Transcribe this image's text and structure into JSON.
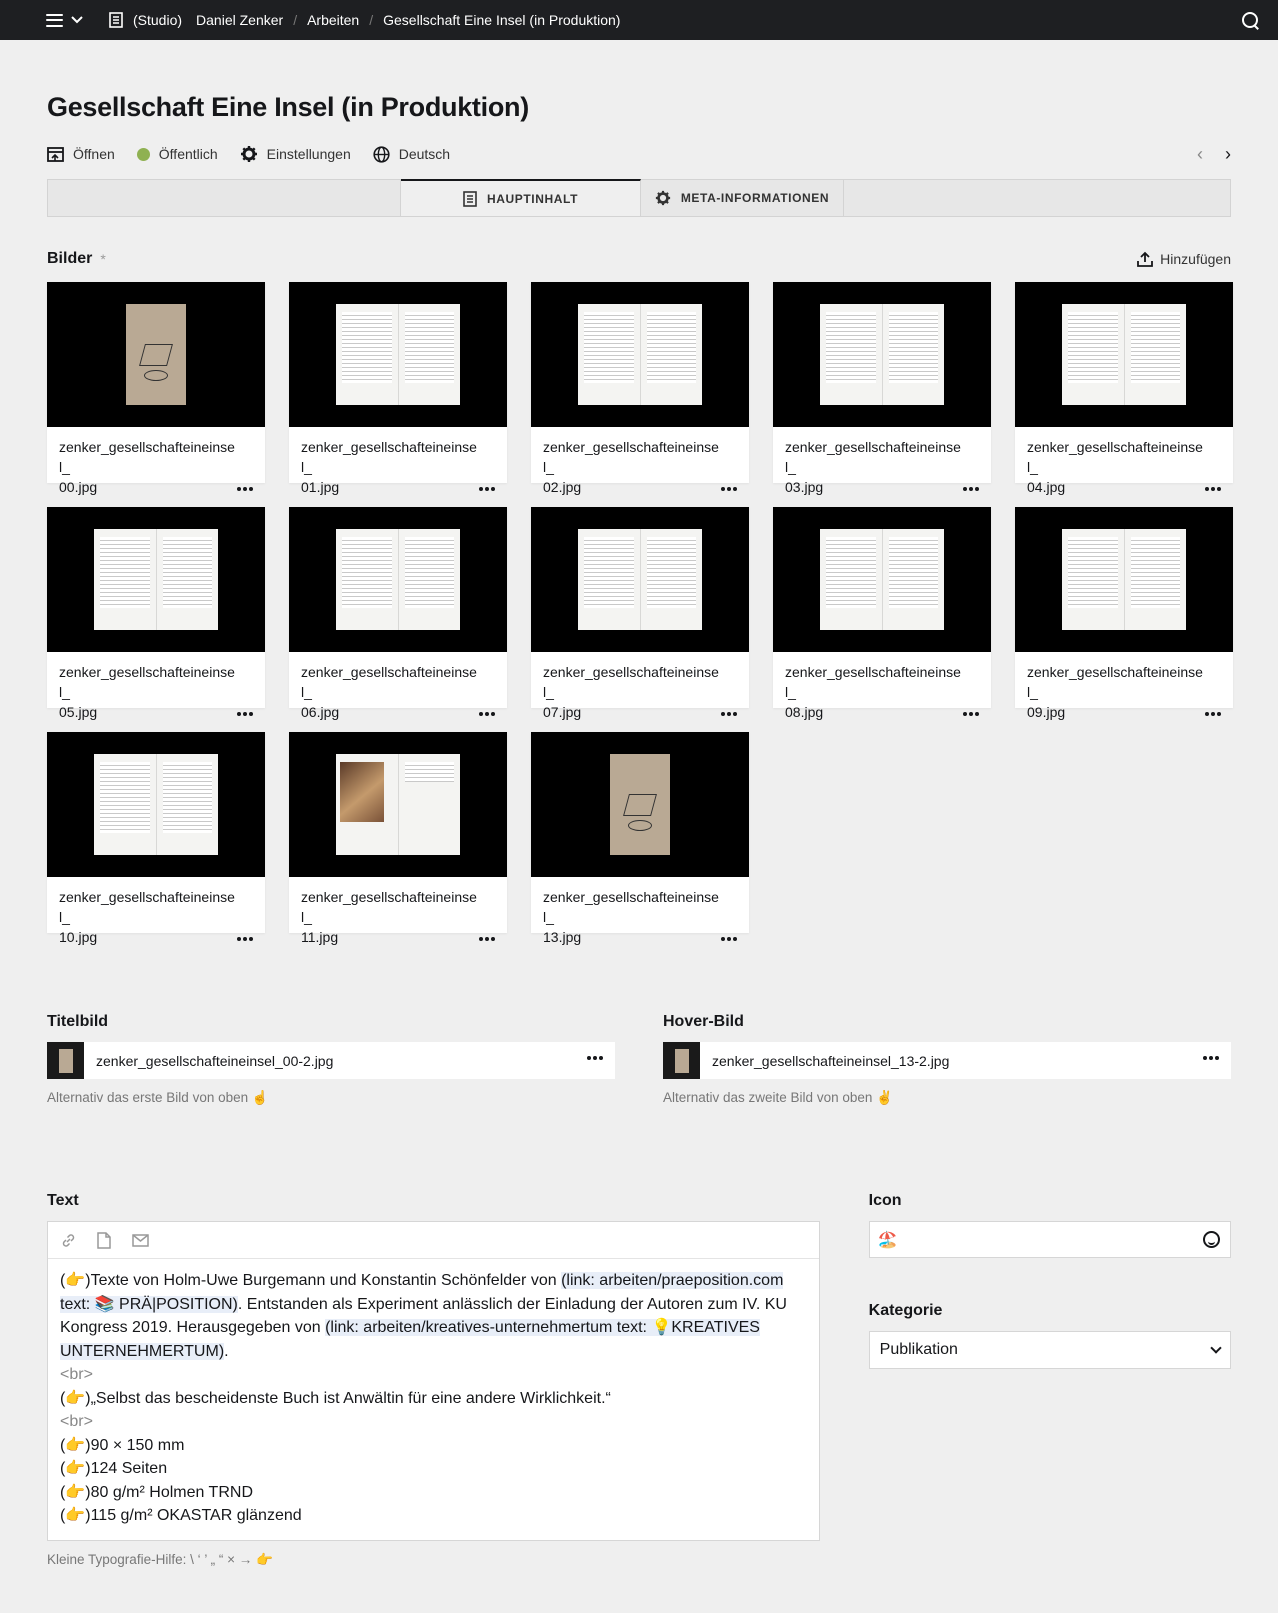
{
  "breadcrumb": [
    "(Studio)",
    "Daniel Zenker",
    "Arbeiten",
    "Gesellschaft Eine Insel (in Produktion)"
  ],
  "title": "Gesellschaft Eine Insel (in Produktion)",
  "actions": {
    "open": "Öffnen",
    "status": "Öffentlich",
    "settings": "Einstellungen",
    "language": "Deutsch"
  },
  "status_color": "#8fb152",
  "tabs": {
    "main": "HAUPTINHALT",
    "meta": "META-INFORMATIONEN"
  },
  "images": {
    "label": "Bilder",
    "required": "*",
    "add": "Hinzufügen",
    "files": [
      {
        "line1": "zenker_gesellschafteineinsel_",
        "line2": "00.jpg",
        "kind": "cover"
      },
      {
        "line1": "zenker_gesellschafteineinsel_",
        "line2": "01.jpg",
        "kind": "spread"
      },
      {
        "line1": "zenker_gesellschafteineinsel_",
        "line2": "02.jpg",
        "kind": "spread"
      },
      {
        "line1": "zenker_gesellschafteineinsel_",
        "line2": "03.jpg",
        "kind": "spread"
      },
      {
        "line1": "zenker_gesellschafteineinsel_",
        "line2": "04.jpg",
        "kind": "spread"
      },
      {
        "line1": "zenker_gesellschafteineinsel_",
        "line2": "05.jpg",
        "kind": "spread"
      },
      {
        "line1": "zenker_gesellschafteineinsel_",
        "line2": "06.jpg",
        "kind": "spread"
      },
      {
        "line1": "zenker_gesellschafteineinsel_",
        "line2": "07.jpg",
        "kind": "spread"
      },
      {
        "line1": "zenker_gesellschafteineinsel_",
        "line2": "08.jpg",
        "kind": "spread"
      },
      {
        "line1": "zenker_gesellschafteineinsel_",
        "line2": "09.jpg",
        "kind": "spread"
      },
      {
        "line1": "zenker_gesellschafteineinsel_",
        "line2": "10.jpg",
        "kind": "spread"
      },
      {
        "line1": "zenker_gesellschafteineinsel_",
        "line2": "11.jpg",
        "kind": "photo"
      },
      {
        "line1": "zenker_gesellschafteineinsel_",
        "line2": "13.jpg",
        "kind": "cover"
      }
    ]
  },
  "titelbild": {
    "label": "Titelbild",
    "file": "zenker_gesellschafteineinsel_00-2.jpg",
    "help": "Alternativ das erste Bild von oben ☝️"
  },
  "hoverbild": {
    "label": "Hover-Bild",
    "file": "zenker_gesellschafteineinsel_13-2.jpg",
    "help": "Alternativ das zweite Bild von oben ✌️"
  },
  "text": {
    "label": "Text",
    "lines": [
      {
        "parts": [
          {
            "t": "(👉)Texte von Holm-Uwe Burgemann und Konstantin Schönfelder von ",
            "c": ""
          },
          {
            "t": "(link: arbeiten/praeposition.com text: 📚 PRÄ|POSITION)",
            "c": "link"
          },
          {
            "t": ". Entstanden als Experiment anlässlich der Einladung der Autoren zum IV. KU Kongress 2019. Herausgegeben von ",
            "c": ""
          },
          {
            "t": "(link: arbeiten/kreatives-unternehmertum text: 💡KREATIVES UNTERNEHMERTUM)",
            "c": "link"
          },
          {
            "t": ".",
            "c": ""
          }
        ]
      },
      {
        "parts": [
          {
            "t": "<br>",
            "c": "muted"
          }
        ]
      },
      {
        "parts": [
          {
            "t": "(👉)„Selbst das bescheidenste Buch ist Anwältin für eine andere Wirklichkeit.“",
            "c": ""
          }
        ]
      },
      {
        "parts": [
          {
            "t": "<br>",
            "c": "muted"
          }
        ]
      },
      {
        "parts": [
          {
            "t": "(👉)90 × 150 mm",
            "c": ""
          }
        ]
      },
      {
        "parts": [
          {
            "t": "(👉)124 Seiten",
            "c": ""
          }
        ]
      },
      {
        "parts": [
          {
            "t": "(👉)80 g/m² Holmen TRND",
            "c": ""
          }
        ]
      },
      {
        "parts": [
          {
            "t": "(👉)115 g/m² OKASTAR glänzend",
            "c": ""
          }
        ]
      }
    ],
    "help": "Kleine Typografie-Hilfe: \\ ‘ ’ „ “ × → 👉"
  },
  "icon": {
    "label": "Icon",
    "value": "🏖️"
  },
  "kategorie": {
    "label": "Kategorie",
    "value": "Publikation"
  }
}
